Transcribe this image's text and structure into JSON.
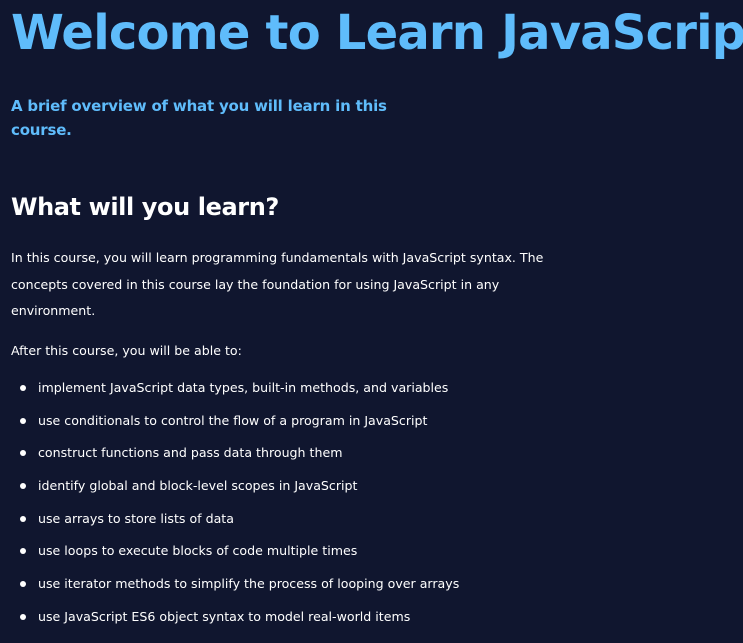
{
  "page": {
    "title": "Welcome to Learn JavaScript",
    "subtitle": "A brief overview of what you will learn in this course."
  },
  "section": {
    "heading": "What will you learn?",
    "intro": "In this course, you will learn programming fundamentals with JavaScript syntax. The concepts covered in this course lay the foundation for using JavaScript in any environment.",
    "lead": "After this course, you will be able to:",
    "outcomes": [
      "implement JavaScript data types, built-in methods, and variables",
      "use conditionals to control the flow of a program in JavaScript",
      "construct functions and pass data through them",
      "identify global and block-level scopes in JavaScript",
      "use arrays to store lists of data",
      "use loops to execute blocks of code multiple times",
      "use iterator methods to simplify the process of looping over arrays",
      "use JavaScript ES6 object syntax to model real-world items"
    ]
  },
  "colors": {
    "background": "#10162f",
    "accent": "#5fbcfb",
    "text": "#ffffff"
  },
  "icons": {
    "bullet": "bullet-dot-icon"
  }
}
